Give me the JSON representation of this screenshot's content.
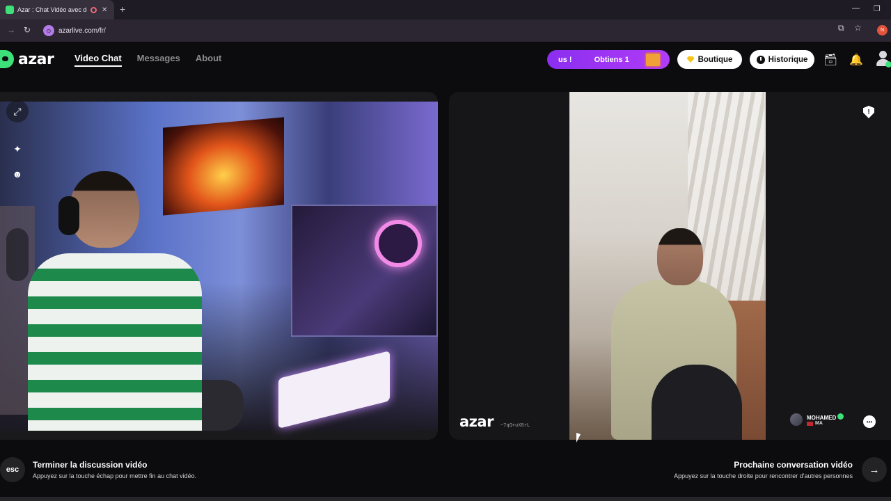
{
  "browser": {
    "tab_title": "Azar : Chat Vidéo avec de n",
    "new_tab_label": "+",
    "url": "azarlive.com/fr/",
    "profile_initial": "N",
    "site_badge": "⊙"
  },
  "header": {
    "logo_text": "azar",
    "nav": [
      {
        "label": "Video Chat",
        "active": true
      },
      {
        "label": "Messages",
        "active": false
      },
      {
        "label": "About",
        "active": false
      }
    ],
    "promo": {
      "left_text": "us !",
      "right_text": "Obtiens 1"
    },
    "shop_label": "Boutique",
    "history_label": "Historique"
  },
  "left_panel": {
    "icons": [
      "expand-icon",
      "magic-wand-icon",
      "sticker-icon"
    ]
  },
  "right_panel": {
    "watermark_logo": "azar",
    "watermark_id": "~7qQ+uX8rL",
    "report_glyph": "!",
    "peer": {
      "name": "MOHAMED",
      "country": "MA",
      "verified": true
    }
  },
  "footer": {
    "esc_label": "esc",
    "end_title": "Terminer la discussion vidéo",
    "end_hint": "Appuyez sur la touche échap pour mettre fin au chat vidéo.",
    "next_title": "Prochaine conversation vidéo",
    "next_hint": "Appuyez sur la touche droite pour rencontrer d'autres personnes",
    "next_arrow": "→"
  },
  "colors": {
    "brand_green": "#3ee07a",
    "promo_purple": "#8b2ef0",
    "background": "#0c0c0e"
  }
}
